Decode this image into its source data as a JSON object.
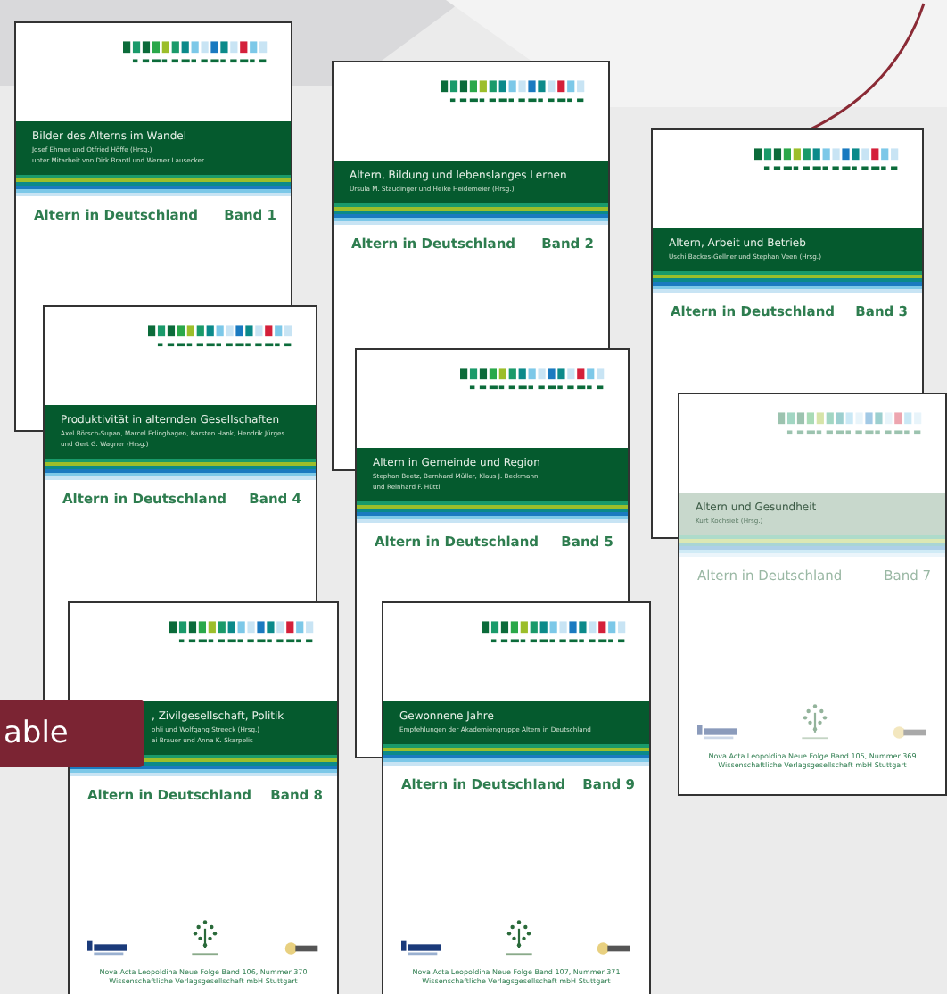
{
  "covers": [
    {
      "kind": "green",
      "title": "Bilder des Alterns im Wandel",
      "authors": [
        "Josef Ehmer und Otfried Höffe (Hrsg.)",
        "unter Mitarbeit von Dirk Brantl und Werner Lausecker"
      ],
      "series": "Altern in Deutschland",
      "band": "Band 1"
    },
    {
      "kind": "green",
      "title": "Altern, Bildung und lebenslanges Lernen",
      "authors": [
        "Ursula M. Staudinger und Heike Heidemeier (Hrsg.)"
      ],
      "series": "Altern in Deutschland",
      "band": "Band 2"
    },
    {
      "kind": "green",
      "title": "Altern, Arbeit und Betrieb",
      "authors": [
        "Uschi Backes-Gellner und Stephan Veen (Hrsg.)"
      ],
      "series": "Altern in Deutschland",
      "band": "Band 3"
    },
    {
      "kind": "green",
      "title": "Produktivität in alternden Gesellschaften",
      "authors": [
        "Axel Börsch-Supan, Marcel Erlinghagen, Karsten Hank, Hendrik Jürges",
        "und Gert G. Wagner (Hrsg.)"
      ],
      "series": "Altern in Deutschland",
      "band": "Band 4"
    },
    {
      "kind": "green",
      "title": "Altern in Gemeinde und Region",
      "authors": [
        "Stephan Beetz, Bernhard Müller, Klaus J. Beckmann",
        "und Reinhard F. Hüttl"
      ],
      "series": "Altern in Deutschland",
      "band": "Band 5"
    },
    {
      "kind": "faded",
      "title": "Altern und Gesundheit",
      "authors": [
        "Kurt Kochsiek (Hrsg.)"
      ],
      "series": "Altern in Deutschland",
      "band": "Band 7",
      "footer": [
        "Nova Acta Leopoldina Neue Folge Band 105, Nummer 369",
        "Wissenschaftliche Verlagsgesellschaft mbH Stuttgart"
      ]
    },
    {
      "kind": "green",
      "title": ", Zivilgesellschaft, Politik",
      "authors": [
        "ohli und Wolfgang Streeck (Hrsg.)",
        "ai Brauer und Anna K. Skarpelis"
      ],
      "series": "Altern in Deutschland",
      "band": "Band 8",
      "footer": [
        "Nova Acta Leopoldina Neue Folge Band 106, Nummer 370",
        "Wissenschaftliche Verlagsgesellschaft mbH Stuttgart"
      ]
    },
    {
      "kind": "green",
      "title": "Gewonnene Jahre",
      "authors": [
        "Empfehlungen der Akademiengruppe Altern in Deutschland"
      ],
      "series": "Altern in Deutschland",
      "band": "Band 9",
      "footer": [
        "Nova Acta Leopoldina Neue Folge Band 107, Nummer 371",
        "Wissenschaftliche Verlagsgesellschaft mbH Stuttgart"
      ]
    }
  ],
  "badge": {
    "label": "able"
  }
}
